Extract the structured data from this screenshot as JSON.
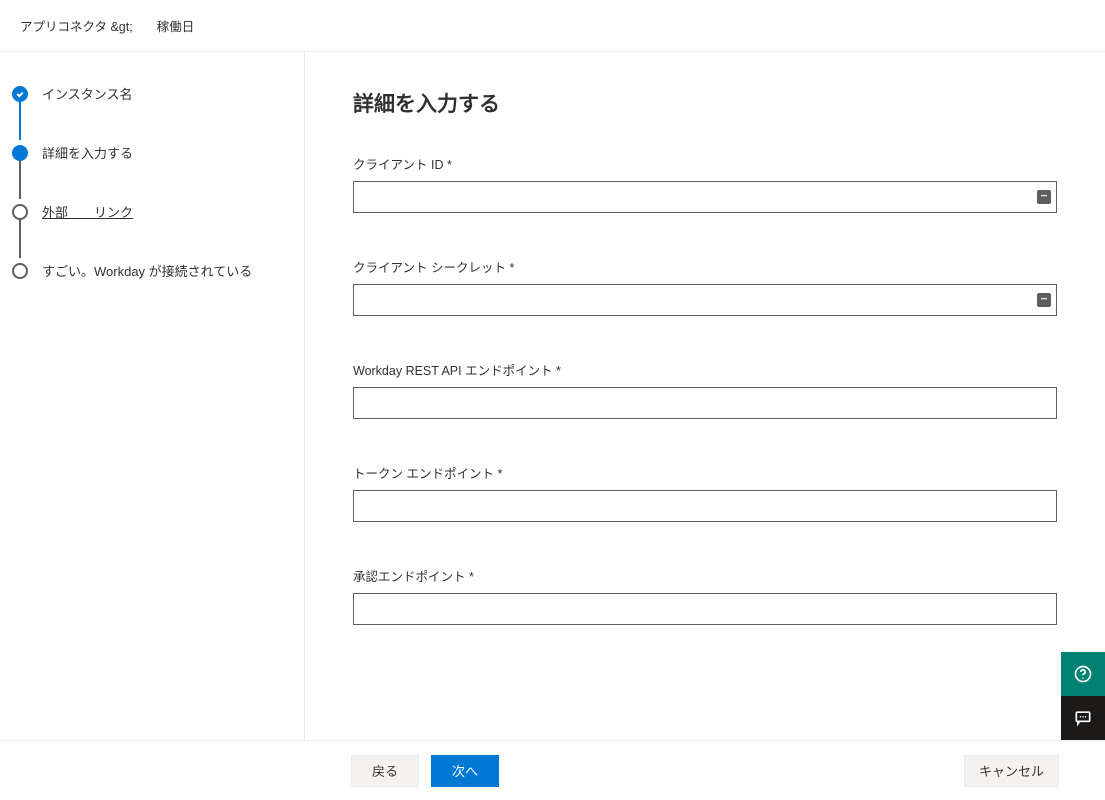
{
  "breadcrumb": {
    "item1": "アプリコネクタ &gt;",
    "item2": "稼働日"
  },
  "steps": [
    {
      "label": "インスタンス名",
      "state": "completed"
    },
    {
      "label": "詳細を入力する",
      "state": "current"
    },
    {
      "label": "外部　　リンク",
      "state": "upcoming",
      "linkLike": true
    },
    {
      "label": "すごい。Workday が接続されている",
      "state": "upcoming"
    }
  ],
  "form": {
    "title": "詳細を入力する",
    "fields": {
      "clientId": {
        "label": "クライアント ID *",
        "value": "",
        "hasIcon": true
      },
      "clientSecret": {
        "label": "クライアント シークレット *",
        "value": "",
        "hasIcon": true
      },
      "restApi": {
        "label": "Workday REST API エンドポイント *",
        "value": "",
        "hasIcon": false
      },
      "tokenEndpoint": {
        "label": "トークン エンドポイント *",
        "value": "",
        "hasIcon": false
      },
      "authEndpoint": {
        "label": "承認エンドポイント *",
        "value": "",
        "hasIcon": false
      }
    }
  },
  "buttons": {
    "back": "戻る",
    "next": "次へ",
    "cancel": "キャンセル"
  },
  "icons": {
    "help": "help-icon",
    "feedback": "feedback-icon"
  }
}
